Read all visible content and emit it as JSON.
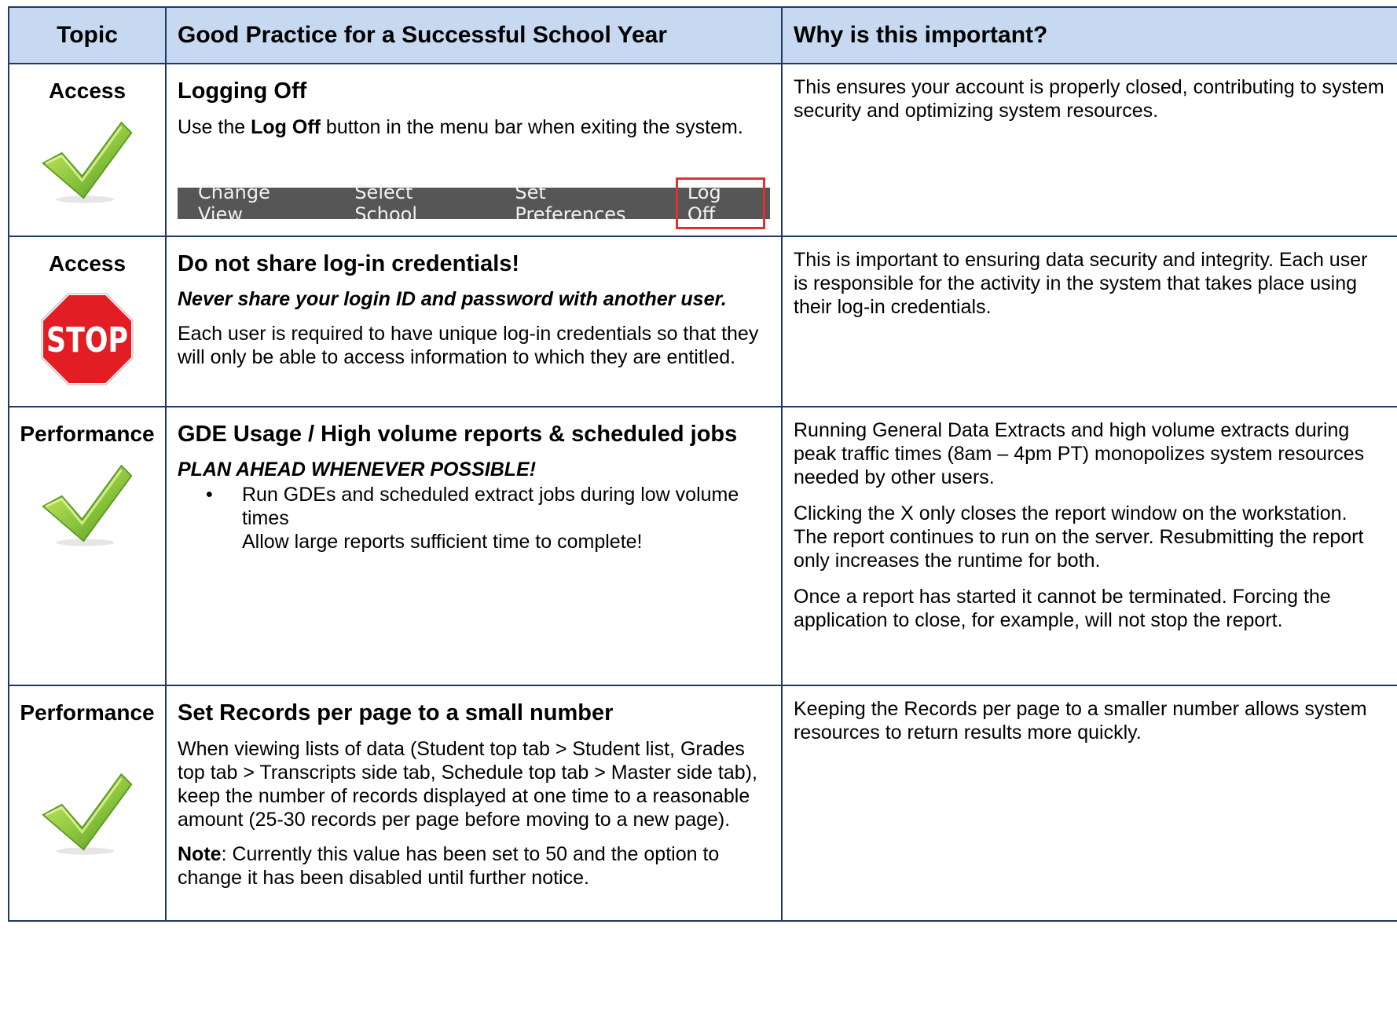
{
  "header": {
    "topic": "Topic",
    "practice": "Good Practice for a Successful School Year",
    "why": "Why is this important?"
  },
  "rows": [
    {
      "topic": "Access",
      "icon": "checkmark-icon",
      "title": "Logging Off",
      "text_pre": "Use the ",
      "text_bold": "Log Off",
      "text_post": " button in the menu bar when exiting the system.",
      "menu": [
        "Change View",
        "Select School",
        "Set Preferences",
        "Log Off"
      ],
      "why": [
        "This ensures your account is properly closed, contributing to system security and optimizing system resources."
      ]
    },
    {
      "topic": "Access",
      "icon": "stop-sign-icon",
      "stop_text": "STOP",
      "title": "Do not share log-in credentials!",
      "emphasis": "Never share your login ID and password with another user.",
      "text": "Each user is required to have unique log-in credentials so that they will only be able to access information to which they are entitled.",
      "why": [
        "This is important to ensuring data security and integrity.  Each user is responsible for the activity in the system that takes place using their log-in credentials."
      ]
    },
    {
      "topic": "Performance",
      "icon": "checkmark-icon",
      "title": "GDE  Usage / High volume reports & scheduled jobs",
      "emphasis": "PLAN AHEAD WHENEVER POSSIBLE!",
      "bullet": "•",
      "bullet_lines": [
        "Run GDEs and scheduled extract jobs during low volume times",
        "Allow large reports sufficient time to complete!"
      ],
      "why": [
        "Running General Data Extracts and high volume extracts during peak traffic times (8am – 4pm PT) monopolizes system resources needed by other users.",
        "Clicking the X only closes the report window on the workstation. The report continues to run on the server. Resubmitting the report only increases the runtime for both.",
        "Once a report has started it cannot be terminated. Forcing the application to close, for example, will not stop the report."
      ]
    },
    {
      "topic": "Performance",
      "icon": "checkmark-icon",
      "title": "Set Records per page to a small number",
      "text": "When viewing lists of data (Student top tab > Student list, Grades top tab > Transcripts side tab, Schedule top tab > Master side tab), keep the number of records displayed at one time to a reasonable amount (25-30 records per page before moving to a new page).",
      "note_label": "Note",
      "note_text": ":  Currently this value has been set to 50 and the option to change it has been disabled until further notice.",
      "why": [
        "Keeping the Records per page to a smaller number allows system resources to return results more quickly."
      ]
    }
  ]
}
